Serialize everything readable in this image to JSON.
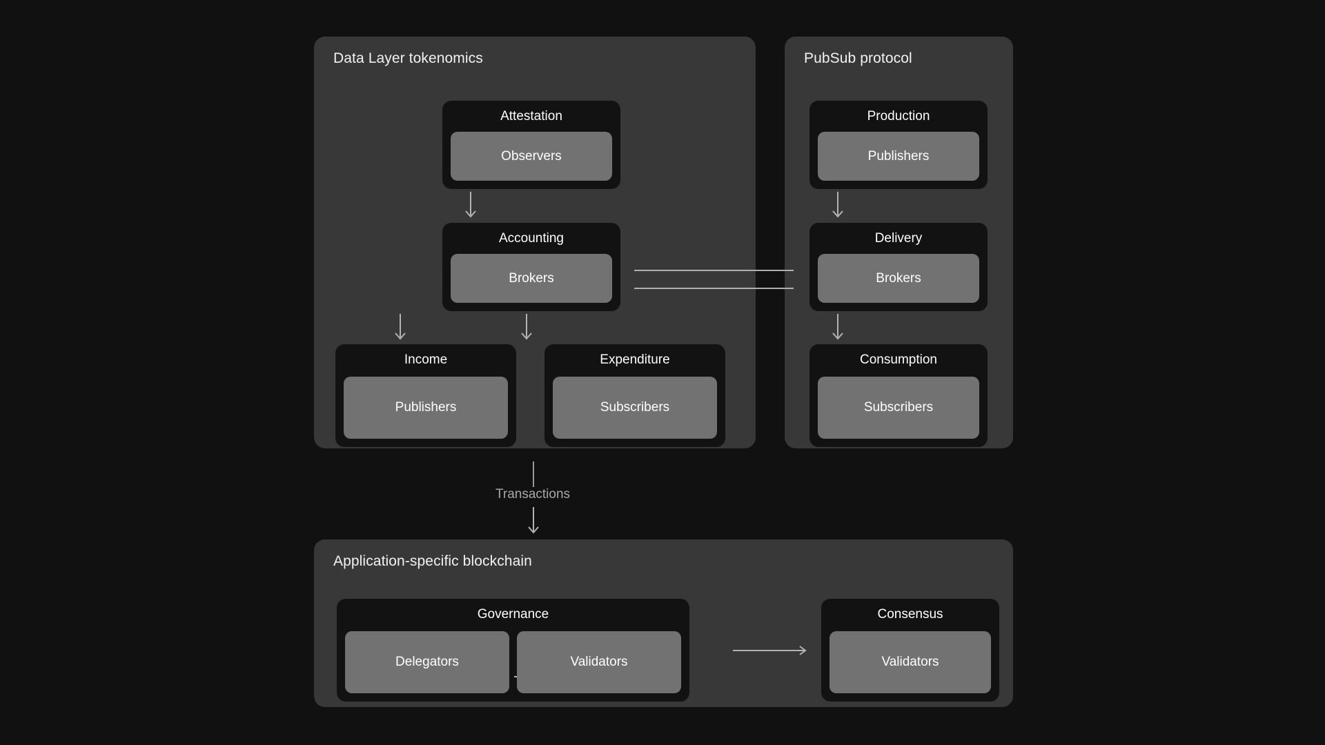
{
  "canvas": {
    "background": "#111111",
    "panel_background": "#383838",
    "box_background": "#121212",
    "chip_background": "#727272",
    "text_color": "#ffffff",
    "muted_text_color": "#a8a8a8",
    "connector_color": "#b4b4b4"
  },
  "panels": {
    "data_layer": {
      "title": "Data Layer tokenomics",
      "boxes": {
        "attestation": {
          "title": "Attestation",
          "chip": "Observers"
        },
        "accounting": {
          "title": "Accounting",
          "chip": "Brokers"
        },
        "income": {
          "title": "Income",
          "chip": "Publishers"
        },
        "expenditure": {
          "title": "Expenditure",
          "chip": "Subscribers"
        }
      }
    },
    "pubsub": {
      "title": "PubSub protocol",
      "boxes": {
        "production": {
          "title": "Production",
          "chip": "Publishers"
        },
        "delivery": {
          "title": "Delivery",
          "chip": "Brokers"
        },
        "consumption": {
          "title": "Consumption",
          "chip": "Subscribers"
        }
      }
    },
    "blockchain": {
      "title": "Application-specific blockchain",
      "boxes": {
        "governance": {
          "title": "Governance",
          "chip_left": "Delegators",
          "chip_right": "Validators"
        },
        "consensus": {
          "title": "Consensus",
          "chip": "Validators"
        }
      }
    }
  },
  "connectors": {
    "transactions_label": "Transactions"
  },
  "chart_data": {
    "type": "diagram",
    "title": "Data Layer tokenomics / PubSub protocol / Application-specific blockchain",
    "groups": [
      {
        "name": "Data Layer tokenomics",
        "nodes": [
          {
            "id": "attestation",
            "label": "Attestation",
            "actor": "Observers"
          },
          {
            "id": "accounting",
            "label": "Accounting",
            "actor": "Brokers"
          },
          {
            "id": "income",
            "label": "Income",
            "actor": "Publishers"
          },
          {
            "id": "expenditure",
            "label": "Expenditure",
            "actor": "Subscribers"
          }
        ]
      },
      {
        "name": "PubSub protocol",
        "nodes": [
          {
            "id": "production",
            "label": "Production",
            "actor": "Publishers"
          },
          {
            "id": "delivery",
            "label": "Delivery",
            "actor": "Brokers"
          },
          {
            "id": "consumption",
            "label": "Consumption",
            "actor": "Subscribers"
          }
        ]
      },
      {
        "name": "Application-specific blockchain",
        "nodes": [
          {
            "id": "governance",
            "label": "Governance",
            "actor": "Delegators → Validators"
          },
          {
            "id": "consensus",
            "label": "Consensus",
            "actor": "Validators"
          }
        ]
      }
    ],
    "edges": [
      {
        "from": "attestation",
        "to": "accounting",
        "style": "arrow-down",
        "label": ""
      },
      {
        "from": "accounting",
        "to": "income",
        "style": "arrow-down",
        "label": ""
      },
      {
        "from": "accounting",
        "to": "expenditure",
        "style": "arrow-down",
        "label": ""
      },
      {
        "from": "production",
        "to": "delivery",
        "style": "arrow-down",
        "label": ""
      },
      {
        "from": "delivery",
        "to": "consumption",
        "style": "arrow-down",
        "label": ""
      },
      {
        "from": "accounting",
        "to": "delivery",
        "style": "double-line",
        "label": ""
      },
      {
        "from": "data-layer-tokenomics",
        "to": "application-specific-blockchain",
        "style": "arrow-down",
        "label": "Transactions"
      },
      {
        "from": "delegators",
        "to": "validators",
        "style": "arrow-right",
        "label": ""
      },
      {
        "from": "governance",
        "to": "consensus",
        "style": "arrow-right",
        "label": ""
      }
    ]
  }
}
